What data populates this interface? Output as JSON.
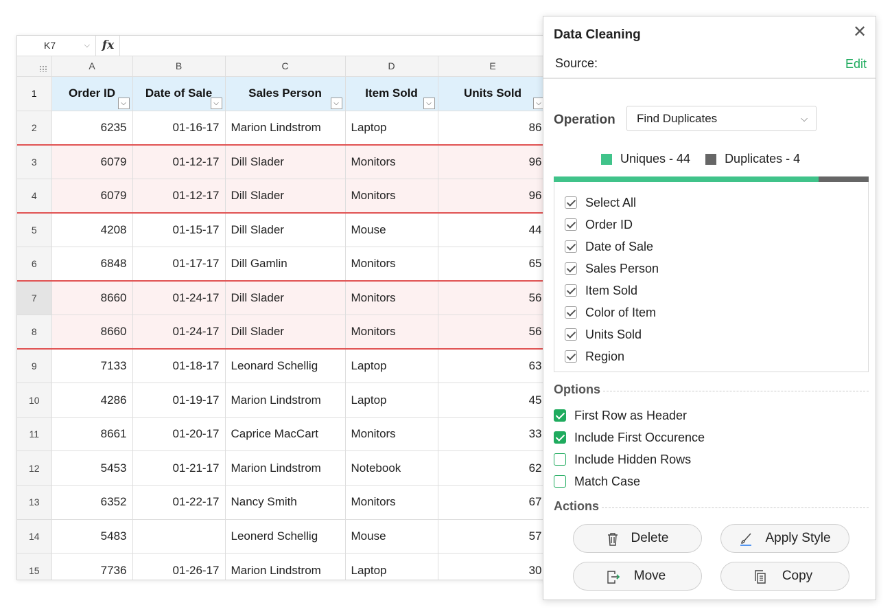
{
  "sheet": {
    "name_box": "K7",
    "fx_label": "fx",
    "columns": [
      "A",
      "B",
      "C",
      "D",
      "E"
    ],
    "headers": [
      "Order ID",
      "Date of Sale",
      "Sales Person",
      "Item Sold",
      "Units Sold"
    ],
    "header_row_number": "1",
    "rows": [
      {
        "n": "2",
        "id": "6235",
        "date": "01-16-17",
        "person": "Marion Lindstrom",
        "item": "Laptop",
        "units": "86"
      },
      {
        "n": "3",
        "id": "6079",
        "date": "01-12-17",
        "person": "Dill Slader",
        "item": "Monitors",
        "units": "96"
      },
      {
        "n": "4",
        "id": "6079",
        "date": "01-12-17",
        "person": "Dill Slader",
        "item": "Monitors",
        "units": "96"
      },
      {
        "n": "5",
        "id": "4208",
        "date": "01-15-17",
        "person": "Dill Slader",
        "item": "Mouse",
        "units": "44"
      },
      {
        "n": "6",
        "id": "6848",
        "date": "01-17-17",
        "person": "Dill Gamlin",
        "item": "Monitors",
        "units": "65"
      },
      {
        "n": "7",
        "id": "8660",
        "date": "01-24-17",
        "person": "Dill Slader",
        "item": "Monitors",
        "units": "56"
      },
      {
        "n": "8",
        "id": "8660",
        "date": "01-24-17",
        "person": "Dill Slader",
        "item": "Monitors",
        "units": "56"
      },
      {
        "n": "9",
        "id": "7133",
        "date": "01-18-17",
        "person": "Leonard Schellig",
        "item": "Laptop",
        "units": "63"
      },
      {
        "n": "10",
        "id": "4286",
        "date": "01-19-17",
        "person": "Marion Lindstrom",
        "item": "Laptop",
        "units": "45"
      },
      {
        "n": "11",
        "id": "8661",
        "date": "01-20-17",
        "person": "Caprice MacCart",
        "item": "Monitors",
        "units": "33"
      },
      {
        "n": "12",
        "id": "5453",
        "date": "01-21-17",
        "person": "Marion Lindstrom",
        "item": "Notebook",
        "units": "62"
      },
      {
        "n": "13",
        "id": "6352",
        "date": "01-22-17",
        "person": "Nancy Smith",
        "item": "Monitors",
        "units": "67"
      },
      {
        "n": "14",
        "id": "5483",
        "date": "",
        "person": "Leonerd Schellig",
        "item": "Mouse",
        "units": "57"
      },
      {
        "n": "15",
        "id": "7736",
        "date": "01-26-17",
        "person": "Marion Lindstrom",
        "item": "Laptop",
        "units": "30"
      }
    ]
  },
  "panel": {
    "title": "Data Cleaning",
    "close_glyph": "✕",
    "source_label": "Source:",
    "edit_label": "Edit",
    "operation_label": "Operation",
    "operation_value": "Find Duplicates",
    "uniques_label": "Uniques - 44",
    "duplicates_label": "Duplicates - 4",
    "uniques_count": 44,
    "duplicates_count": 4,
    "colors": {
      "uniques": "#40c38a",
      "duplicates": "#666666",
      "accent": "#1fab5e",
      "duplicate_border": "#e05252"
    },
    "fields": [
      {
        "label": "Select All",
        "checked": true
      },
      {
        "label": "Order ID",
        "checked": true
      },
      {
        "label": "Date of Sale",
        "checked": true
      },
      {
        "label": "Sales Person",
        "checked": true
      },
      {
        "label": "Item Sold",
        "checked": true
      },
      {
        "label": "Color of Item",
        "checked": true
      },
      {
        "label": "Units Sold",
        "checked": true
      },
      {
        "label": "Region",
        "checked": true
      }
    ],
    "options_label": "Options",
    "options": [
      {
        "label": "First Row as Header",
        "checked": true
      },
      {
        "label": "Include First Occurence",
        "checked": true
      },
      {
        "label": "Include Hidden Rows",
        "checked": false
      },
      {
        "label": "Match Case",
        "checked": false
      }
    ],
    "actions_label": "Actions",
    "actions": {
      "delete": "Delete",
      "apply_style": "Apply Style",
      "move": "Move",
      "copy": "Copy"
    }
  }
}
